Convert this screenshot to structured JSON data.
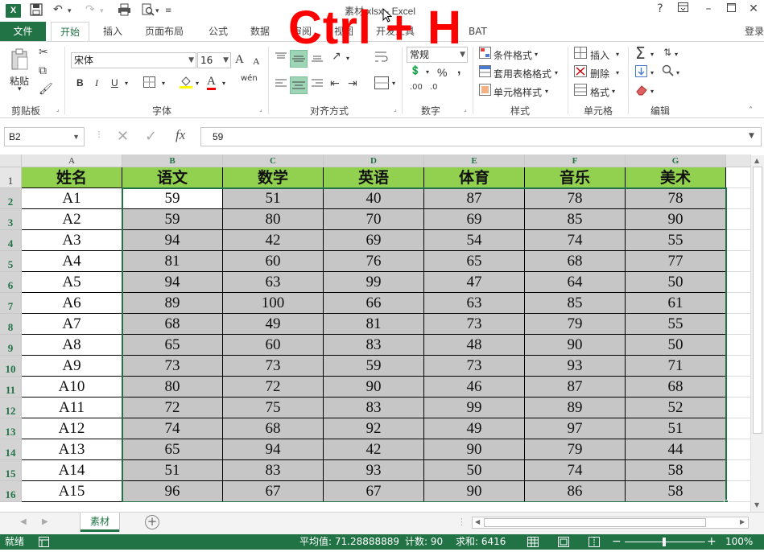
{
  "window": {
    "title": "素材.xlsx - Excel",
    "help": "?",
    "overlay_text": "Ctrl + H"
  },
  "tabs": {
    "file": "文件",
    "home": "开始",
    "insert": "插入",
    "layout": "页面布局",
    "formulas": "公式",
    "data": "数据",
    "review": "审阅",
    "view": "视图",
    "dev": "开发工具",
    "bat": "BAT",
    "signin": "登录"
  },
  "ribbon": {
    "clipboard": {
      "paste": "粘贴",
      "label": "剪贴板"
    },
    "font": {
      "name": "宋体",
      "size": "16",
      "grow": "A",
      "shrink": "A",
      "bold": "B",
      "italic": "I",
      "underline": "U",
      "fill_letter": "A",
      "pinyin": "wén",
      "label": "字体"
    },
    "alignment": {
      "label": "对齐方式"
    },
    "number": {
      "format": "常规",
      "percent": "%",
      "comma": ",",
      "label": "数字"
    },
    "styles": {
      "cond": "条件格式",
      "table": "套用表格格式",
      "cell": "单元格样式",
      "label": "样式"
    },
    "cells": {
      "insert": "插入",
      "delete": "删除",
      "format": "格式",
      "label": "单元格"
    },
    "editing": {
      "label": "编辑"
    }
  },
  "formula_bar": {
    "name_box": "B2",
    "fx": "fx",
    "value": "59"
  },
  "sheet": {
    "columns": [
      "A",
      "B",
      "C",
      "D",
      "E",
      "F",
      "G"
    ],
    "row_numbers": [
      "1",
      "2",
      "3",
      "4",
      "5",
      "6",
      "7",
      "8",
      "9",
      "10",
      "11",
      "12",
      "13",
      "14",
      "15",
      "16"
    ],
    "headers": [
      "姓名",
      "语文",
      "数学",
      "英语",
      "体育",
      "音乐",
      "美术"
    ],
    "rows": [
      [
        "A1",
        "59",
        "51",
        "40",
        "87",
        "78",
        "78"
      ],
      [
        "A2",
        "59",
        "80",
        "70",
        "69",
        "85",
        "90"
      ],
      [
        "A3",
        "94",
        "42",
        "69",
        "54",
        "74",
        "55"
      ],
      [
        "A4",
        "81",
        "60",
        "76",
        "65",
        "68",
        "77"
      ],
      [
        "A5",
        "94",
        "63",
        "99",
        "47",
        "64",
        "50"
      ],
      [
        "A6",
        "89",
        "100",
        "66",
        "63",
        "85",
        "61"
      ],
      [
        "A7",
        "68",
        "49",
        "81",
        "73",
        "79",
        "55"
      ],
      [
        "A8",
        "65",
        "60",
        "83",
        "48",
        "90",
        "50"
      ],
      [
        "A9",
        "73",
        "73",
        "59",
        "73",
        "93",
        "71"
      ],
      [
        "A10",
        "80",
        "72",
        "90",
        "46",
        "87",
        "68"
      ],
      [
        "A11",
        "72",
        "75",
        "83",
        "99",
        "89",
        "52"
      ],
      [
        "A12",
        "74",
        "68",
        "92",
        "49",
        "97",
        "51"
      ],
      [
        "A13",
        "65",
        "94",
        "42",
        "90",
        "79",
        "44"
      ],
      [
        "A14",
        "51",
        "83",
        "93",
        "50",
        "74",
        "58"
      ],
      [
        "A15",
        "96",
        "67",
        "67",
        "90",
        "86",
        "58"
      ]
    ],
    "tab_name": "素材"
  },
  "status": {
    "ready": "就绪",
    "average": "平均值: 71.28888889",
    "count": "计数: 90",
    "sum": "求和: 6416",
    "zoom": "100%"
  },
  "colors": {
    "accent": "#217346",
    "header_fill": "#92d050",
    "selection_fill": "#c6c6c6",
    "overlay": "#ff0000"
  }
}
